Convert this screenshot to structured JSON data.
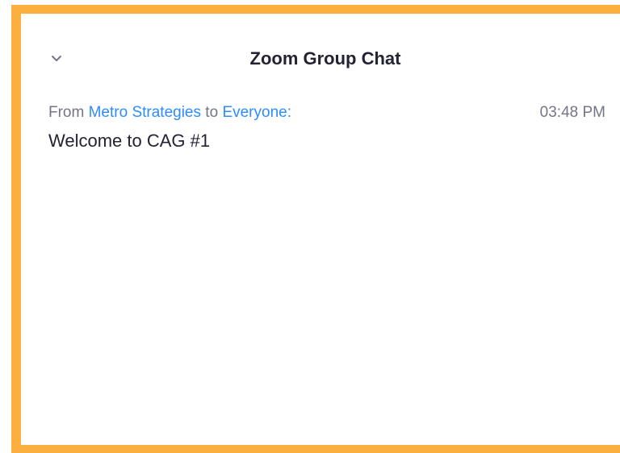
{
  "chat": {
    "title": "Zoom Group Chat",
    "collapse_icon": "chevron-down-icon",
    "messages": [
      {
        "from_prefix": "From",
        "sender": "Metro Strategies",
        "to_word": "to",
        "recipient": "Everyone",
        "colon": ":",
        "time": "03:48 PM",
        "text": "Welcome to CAG #1"
      }
    ]
  },
  "colors": {
    "border": "#FBAF3F",
    "link": "#2D8CFF",
    "meta_text": "#747487",
    "body_text": "#232333"
  }
}
